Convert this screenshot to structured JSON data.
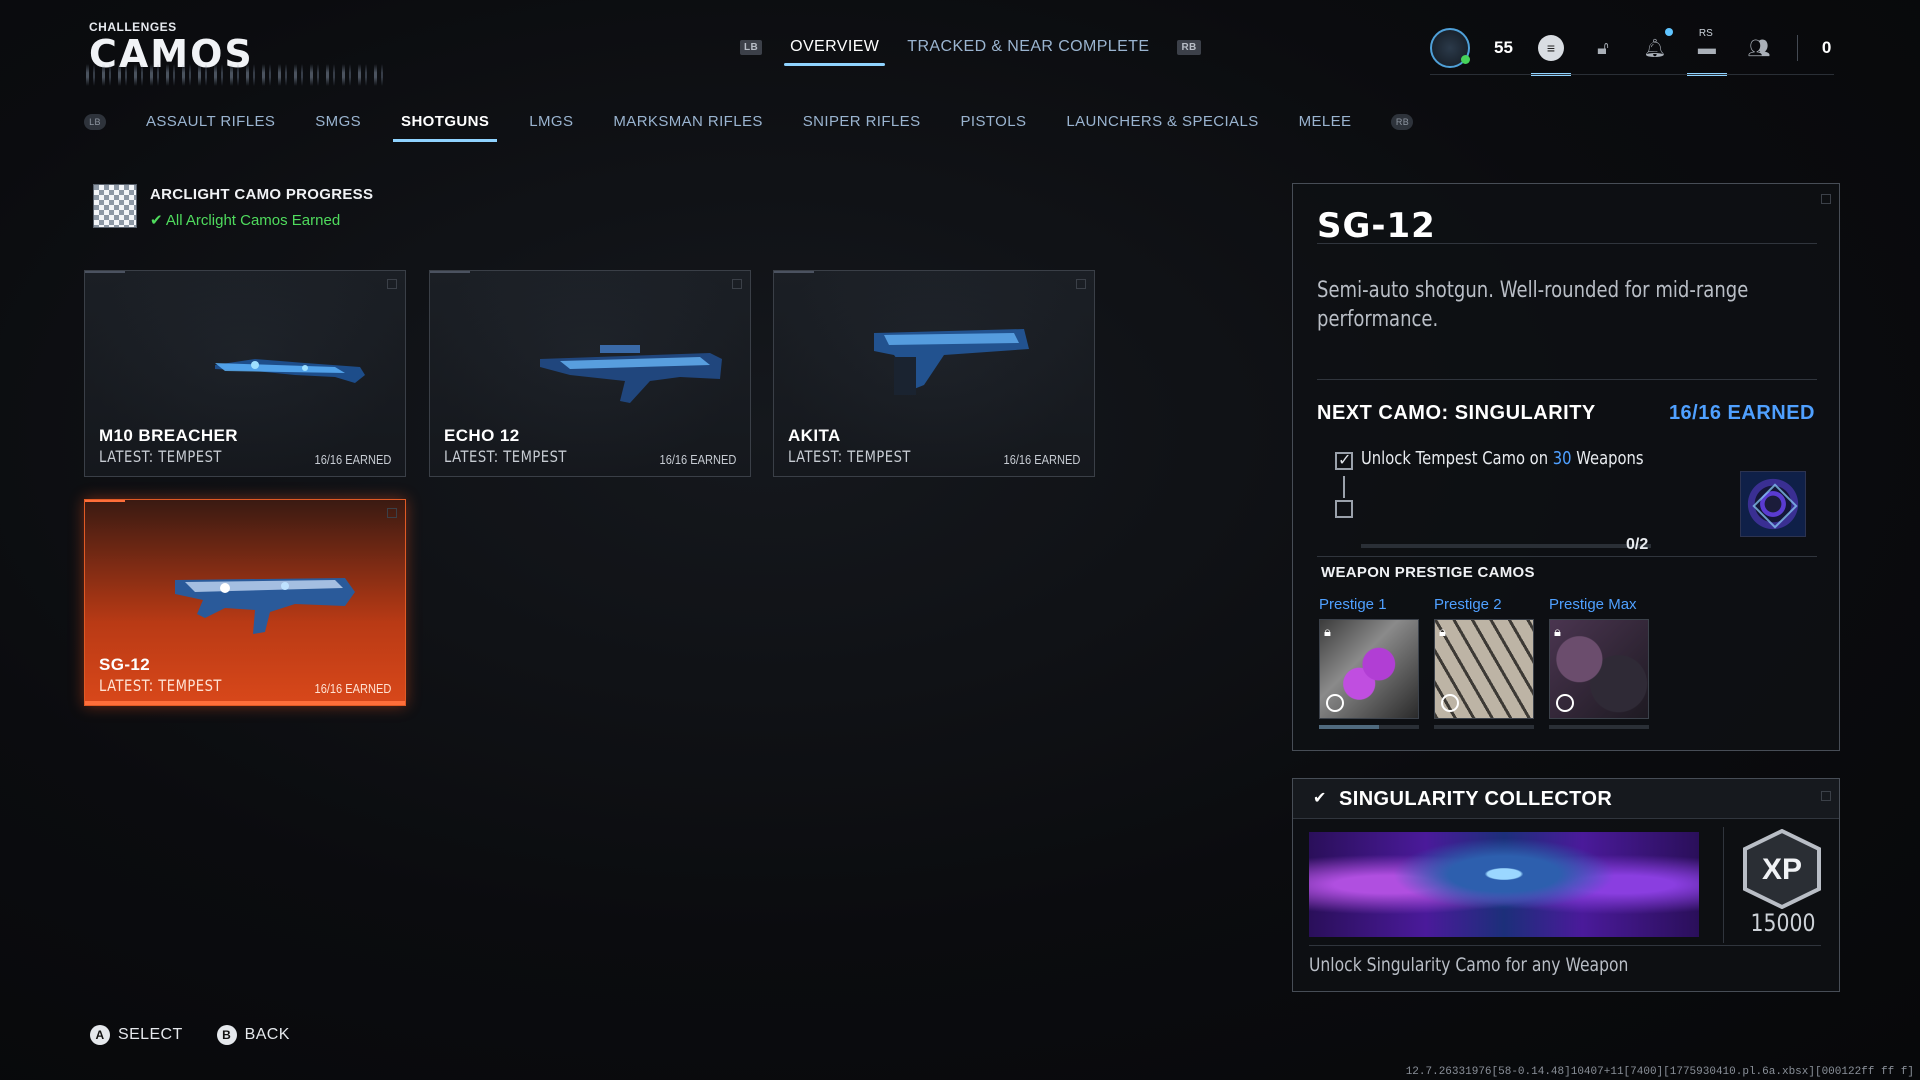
{
  "header": {
    "small_title": "CHALLENGES",
    "title": "CAMOS"
  },
  "topnav": {
    "lb": "LB",
    "rb": "RB",
    "tabs": [
      {
        "label": "OVERVIEW",
        "active": true
      },
      {
        "label": "TRACKED & NEAR COMPLETE",
        "active": false
      }
    ]
  },
  "status": {
    "level": "55",
    "rs_label": "RS",
    "count": "0"
  },
  "categories": {
    "lb_glyph": "LB",
    "rb_glyph": "RB",
    "items": [
      "ASSAULT RIFLES",
      "SMGS",
      "SHOTGUNS",
      "LMGS",
      "MARKSMAN RIFLES",
      "SNIPER RIFLES",
      "PISTOLS",
      "LAUNCHERS & SPECIALS",
      "MELEE"
    ],
    "selected": "SHOTGUNS"
  },
  "arclight": {
    "title": "ARCLIGHT CAMO PROGRESS",
    "subtitle": "All Arclight Camos Earned"
  },
  "weapons": [
    {
      "name": "M10 BREACHER",
      "latest": "LATEST: TEMPEST",
      "earned": "16/16 EARNED"
    },
    {
      "name": "ECHO 12",
      "latest": "LATEST: TEMPEST",
      "earned": "16/16 EARNED"
    },
    {
      "name": "AKITA",
      "latest": "LATEST: TEMPEST",
      "earned": "16/16 EARNED"
    },
    {
      "name": "SG-12",
      "latest": "LATEST: TEMPEST",
      "earned": "16/16 EARNED",
      "selected": true
    }
  ],
  "detail": {
    "title": "SG-12",
    "description": "Semi-auto shotgun. Well-rounded for mid-range performance.",
    "next_camo": "NEXT CAMO: SINGULARITY",
    "earned": "16/16 EARNED",
    "task_prefix": "Unlock Tempest Camo on",
    "task_value": "30",
    "task_suffix": "Weapons",
    "progress": "0/2",
    "progress_fraction": 0,
    "prestige_heading": "WEAPON PRESTIGE CAMOS",
    "prestige": [
      {
        "label": "Prestige 1",
        "locked": true
      },
      {
        "label": "Prestige 2",
        "locked": true
      },
      {
        "label": "Prestige Max",
        "locked": true
      }
    ]
  },
  "collector": {
    "title": "SINGULARITY COLLECTOR",
    "xp_label": "XP",
    "xp": "15000",
    "description": "Unlock Singularity Camo for any Weapon"
  },
  "footer": {
    "select_key": "A",
    "select": "SELECT",
    "back_key": "B",
    "back": "BACK"
  },
  "build": "12.7.26331976[58-0.14.48]10407+11[7400][1775930410.pl.6a.xbsx][000122ff ff f]",
  "colors": {
    "accent_blue": "#4fa0ff",
    "selected_orange": "#d9481a",
    "success_green": "#4fdb5d"
  }
}
